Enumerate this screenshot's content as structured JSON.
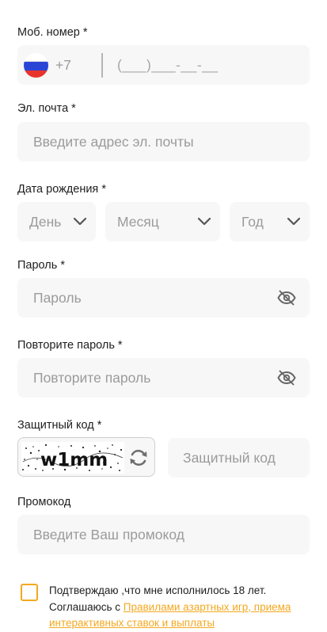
{
  "phone": {
    "label": "Моб. номер *",
    "country_code": "+7",
    "mask": "(___)___-__-__",
    "flag_icon": "russia-flag-icon"
  },
  "email": {
    "label": "Эл. почта *",
    "placeholder": "Введите адрес эл. почты"
  },
  "birthdate": {
    "label": "Дата рождения *",
    "day_placeholder": "День",
    "month_placeholder": "Месяц",
    "year_placeholder": "Год"
  },
  "password": {
    "label": "Пароль *",
    "placeholder": "Пароль",
    "toggle_icon": "eye-slash-icon"
  },
  "password_repeat": {
    "label": "Повторите пароль *",
    "placeholder": "Повторите пароль",
    "toggle_icon": "eye-slash-icon"
  },
  "captcha": {
    "label": "Защитный код *",
    "image_text": "w1mm",
    "placeholder": "Защитный код",
    "refresh_icon": "refresh-icon"
  },
  "promo": {
    "label": "Промокод",
    "placeholder": "Введите Ваш промокод"
  },
  "agreement": {
    "text_before": "Подтверждаю ,что мне исполнилось 18 лет. Соглашаюсь с ",
    "link_text": "Правилами азартных игр, приема интерактивных ставок и выплаты",
    "checked": false
  },
  "colors": {
    "accent": "#f4a820",
    "field_background": "#f7f7f8",
    "placeholder_text": "#9b9b9b"
  }
}
